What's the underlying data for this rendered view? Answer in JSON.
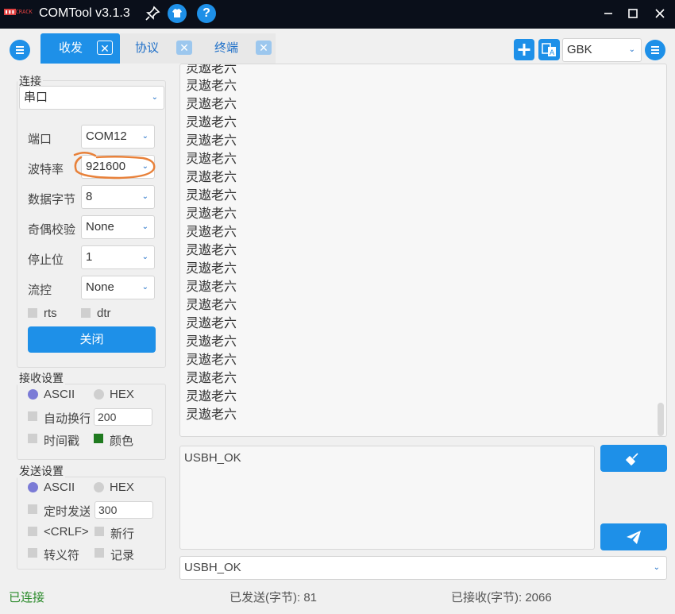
{
  "window": {
    "logo_text": "CRACK",
    "title": "COMTool v3.1.3",
    "help_icon_text": "?",
    "icons": [
      "pin-icon",
      "skin-icon",
      "help-icon",
      "minimize-icon",
      "maximize-icon",
      "close-icon"
    ]
  },
  "toolbar": {
    "encoding": "GBK",
    "icons": [
      "menu-icon",
      "add-icon",
      "translate-icon",
      "settings-menu-icon"
    ]
  },
  "tabs": [
    {
      "label": "收发",
      "active": true
    },
    {
      "label": "协议",
      "active": false
    },
    {
      "label": "终端",
      "active": false
    }
  ],
  "connection": {
    "group_title": "连接",
    "type": "串口",
    "port_label": "端口",
    "port": "COM12",
    "baud_label": "波特率",
    "baud": "921600",
    "databits_label": "数据字节",
    "databits": "8",
    "parity_label": "奇偶校验",
    "parity": "None",
    "stopbits_label": "停止位",
    "stopbits": "1",
    "flow_label": "流控",
    "flow": "None",
    "rts_label": "rts",
    "dtr_label": "dtr",
    "close_button": "关闭"
  },
  "receive_settings": {
    "group_title": "接收设置",
    "ascii_label": "ASCII",
    "hex_label": "HEX",
    "auto_newline_label": "自动换行",
    "auto_newline_value": "200",
    "timestamp_label": "时间戳",
    "color_label": "颜色",
    "selected_mode": "ASCII"
  },
  "send_settings": {
    "group_title": "发送设置",
    "ascii_label": "ASCII",
    "hex_label": "HEX",
    "timed_send_label": "定时发送",
    "timed_send_value": "300",
    "crlf_label": "<CRLF>",
    "newline_label": "新行",
    "escape_label": "转义符",
    "record_label": "记录",
    "selected_mode": "ASCII"
  },
  "receive": {
    "lines": [
      "灵遨老六",
      "灵遨老六",
      "灵遨老六",
      "灵遨老六",
      "灵遨老六",
      "灵遨老六",
      "灵遨老六",
      "灵遨老六",
      "灵遨老六",
      "灵遨老六",
      "灵遨老六",
      "灵遨老六",
      "灵遨老六",
      "灵遨老六",
      "灵遨老六",
      "灵遨老六",
      "灵遨老六",
      "灵遨老六",
      "灵遨老六",
      "灵遨老六"
    ]
  },
  "send": {
    "text": "USBH_OK",
    "history_value": "USBH_OK",
    "icons": [
      "clear-icon",
      "send-icon"
    ]
  },
  "status": {
    "connection": "已连接",
    "sent": "已发送(字节): 81",
    "received": "已接收(字节): 2066",
    "colors": {
      "connected": "#2a8a2a",
      "accent": "#1e90e8",
      "annotation": "#e8813a"
    }
  }
}
